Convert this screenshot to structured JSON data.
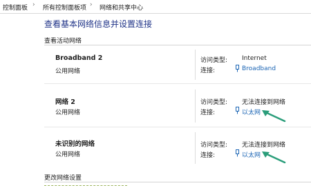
{
  "breadcrumb": {
    "items": [
      "控制面板",
      "所有控制面板项",
      "网络和共享中心"
    ],
    "separator": "›"
  },
  "page_title": "查看基本网络信息并设置连接",
  "active_section_title": "查看活动网络",
  "labels": {
    "access_type": "访问类型:",
    "connection": "连接:"
  },
  "networks": [
    {
      "name": "Broadband 2",
      "category": "公用网络",
      "access_type": "Internet",
      "connection": "Broadband",
      "icon": "connection-icon"
    },
    {
      "name": "网络 2",
      "category": "公用网络",
      "access_type": "无法连接到网络",
      "connection": "以太网",
      "icon": "ethernet-icon"
    },
    {
      "name": "未识别的网络",
      "category": "公用网络",
      "access_type": "无法连接到网络",
      "connection": "以太网",
      "icon": "ethernet-icon"
    }
  ],
  "change_section_title": "更改网络设置",
  "colors": {
    "title": "#1e3287",
    "link": "#1a64b4",
    "arrow": "#2a9d7a"
  }
}
